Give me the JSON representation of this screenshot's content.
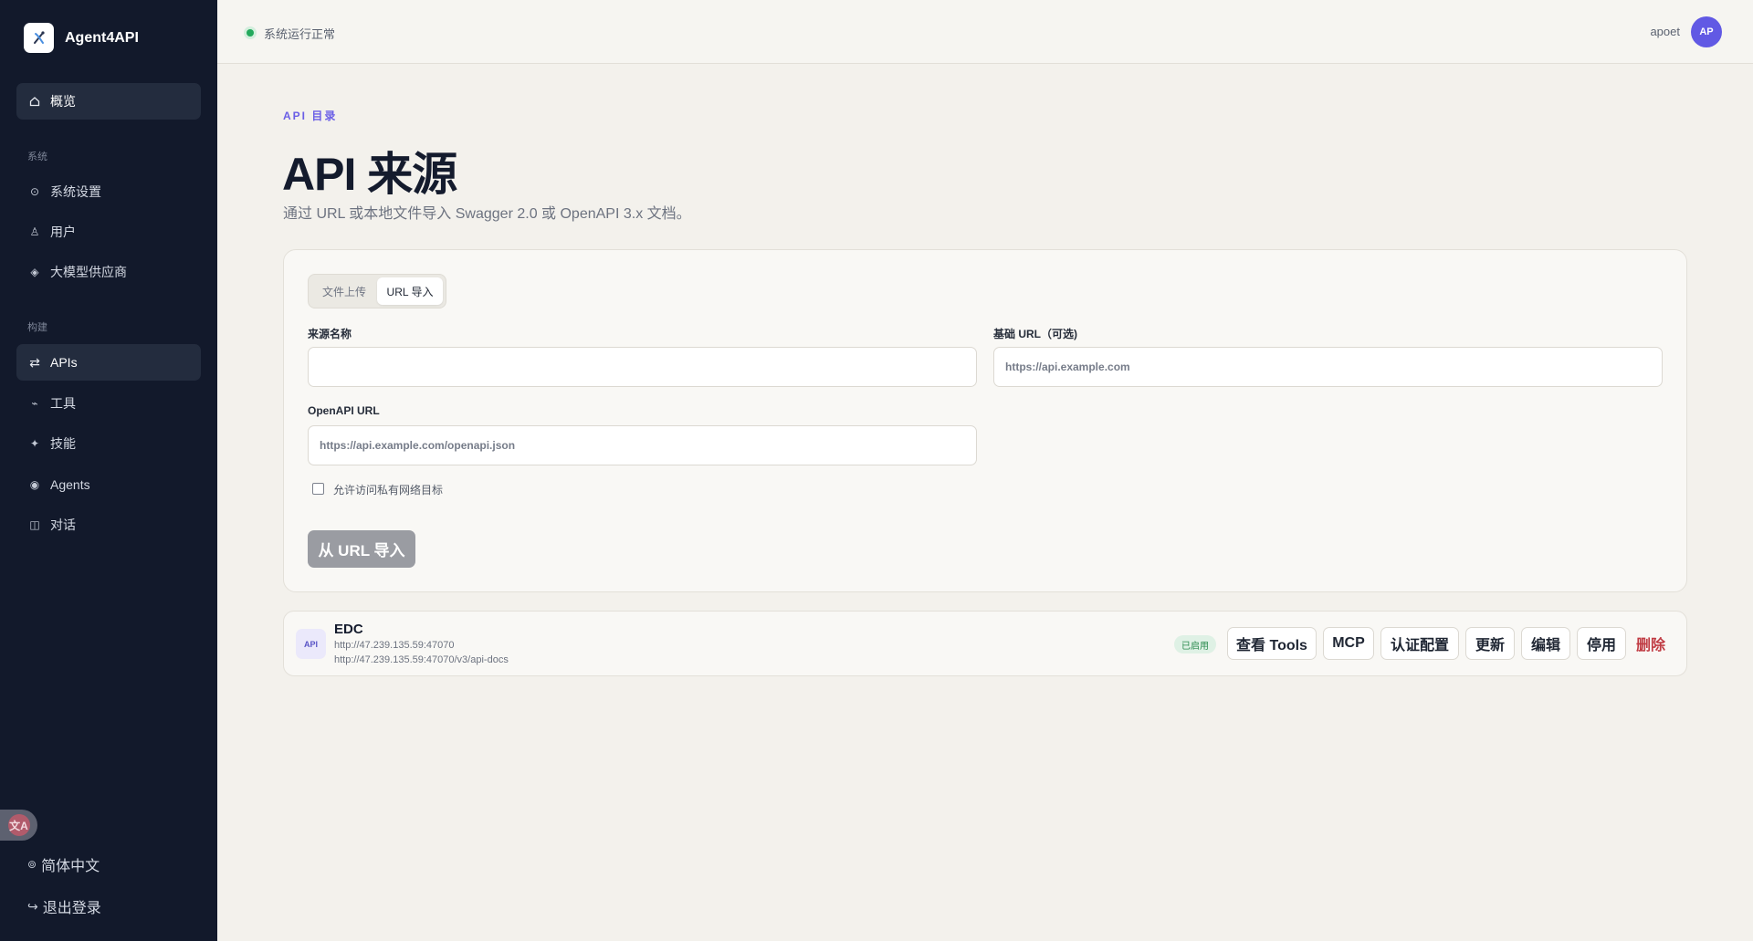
{
  "app": {
    "name": "Agent4API",
    "logo_icon": "agent-logo-icon"
  },
  "sidebar": {
    "overview": {
      "label": "概览",
      "icon": "home-icon"
    },
    "sections": [
      {
        "title": "系统",
        "items": [
          {
            "label": "系统设置",
            "icon": "settings-icon"
          },
          {
            "label": "用户",
            "icon": "user-icon"
          },
          {
            "label": "大模型供应商",
            "icon": "diamond-icon"
          }
        ]
      },
      {
        "title": "构建",
        "items": [
          {
            "label": "APIs",
            "icon": "swap-arrows-icon"
          },
          {
            "label": "工具",
            "icon": "tool-icon"
          },
          {
            "label": "技能",
            "icon": "sparkle-icon"
          },
          {
            "label": "Agents",
            "icon": "target-icon"
          },
          {
            "label": "对话",
            "icon": "chat-panel-icon"
          }
        ]
      }
    ],
    "language": "简体中文",
    "logout": "退出登录"
  },
  "topbar": {
    "status_text": "系统运行正常",
    "user_name": "apoet",
    "avatar_initials": "AP"
  },
  "page": {
    "eyebrow": "API 目录",
    "title": "API 来源",
    "subtitle": "通过 URL 或本地文件导入 Swagger 2.0 或 OpenAPI 3.x 文档。"
  },
  "import_form": {
    "tabs": [
      "文件上传",
      "URL 导入"
    ],
    "active_tab": "URL 导入",
    "source_name": {
      "label": "来源名称",
      "value": "",
      "placeholder": ""
    },
    "base_url": {
      "label": "基础 URL（可选)",
      "placeholder": "https://api.example.com"
    },
    "openapi_url": {
      "label": "OpenAPI URL",
      "placeholder": "https://api.example.com/openapi.json"
    },
    "allow_private_label": "允许访问私有网络目标",
    "allow_private_checked": false,
    "submit_label": "从 URL 导入"
  },
  "sources": [
    {
      "badge": "API",
      "name": "EDC",
      "base_url": "http://47.239.135.59:47070",
      "spec_url": "http://47.239.135.59:47070/v3/api-docs",
      "status": "已启用",
      "status_color": "#2a8a4d",
      "actions": [
        "查看 Tools",
        "MCP",
        "认证配置",
        "更新",
        "编辑",
        "停用"
      ],
      "delete_label": "删除",
      "delete_color": "#c03b43"
    }
  ],
  "colors": {
    "sidebar_bg": "#12192b",
    "accent": "#6a5ee6",
    "status_ok": "#23a95c",
    "avatar_bg": "#6159e4"
  }
}
